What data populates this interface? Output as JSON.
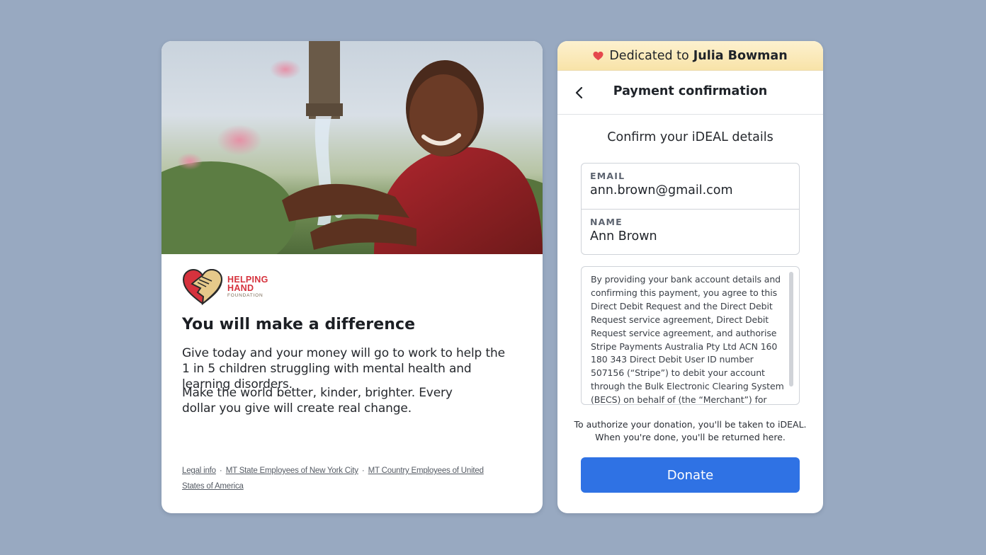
{
  "left_card": {
    "hero_image": {
      "subject": "girl washing hands under water tap",
      "icon": "photo"
    },
    "logo": {
      "line1": "HELPING",
      "line2": "HAND",
      "line3": "FOUNDATION",
      "colors": {
        "heart": "#d6323d",
        "hand": "#e6c98a",
        "outline": "#2a2a2a"
      }
    },
    "headline": "You will make a difference",
    "paragraph1": "Give today and your money will go to work to help the 1 in 5 children struggling with mental health and learning disorders.",
    "paragraph2": "Make the world better, kinder, brighter. Every dollar you give will create real change.",
    "footer": {
      "links": [
        "Legal info",
        "MT State Employees of New York City",
        "MT Country Employees of United States of America"
      ],
      "separator": "·"
    }
  },
  "right_card": {
    "dedication": {
      "prefix": "Dedicated to",
      "name": "Julia Bowman",
      "icon": "heart-icon"
    },
    "nav": {
      "title": "Payment confirmation",
      "back_icon": "chevron-left-icon"
    },
    "subtitle": "Confirm your iDEAL details",
    "fields": {
      "email": {
        "label": "EMAIL",
        "value": "ann.brown@gmail.com"
      },
      "name": {
        "label": "NAME",
        "value": "Ann Brown"
      }
    },
    "terms": "By providing your bank account details and confirming this payment, you agree to this Direct Debit Request and the Direct Debit Request service agreement, Direct Debit Request service agreement, and authorise Stripe Payments Australia Pty Ltd ACN 160 180 343 Direct Debit User ID number 507156 (“Stripe”) to debit your account through the Bulk Electronic Clearing System (BECS) on behalf of (the “Merchant”) for any amounts",
    "notice_line1": "To authorize your donation, you'll be taken to iDEAL.",
    "notice_line2": "When you're done, you'll be returned here.",
    "donate_label": "Donate",
    "colors": {
      "accent": "#2f72e4",
      "banner": "#f8e3a8",
      "heart": "#e5484d"
    }
  }
}
